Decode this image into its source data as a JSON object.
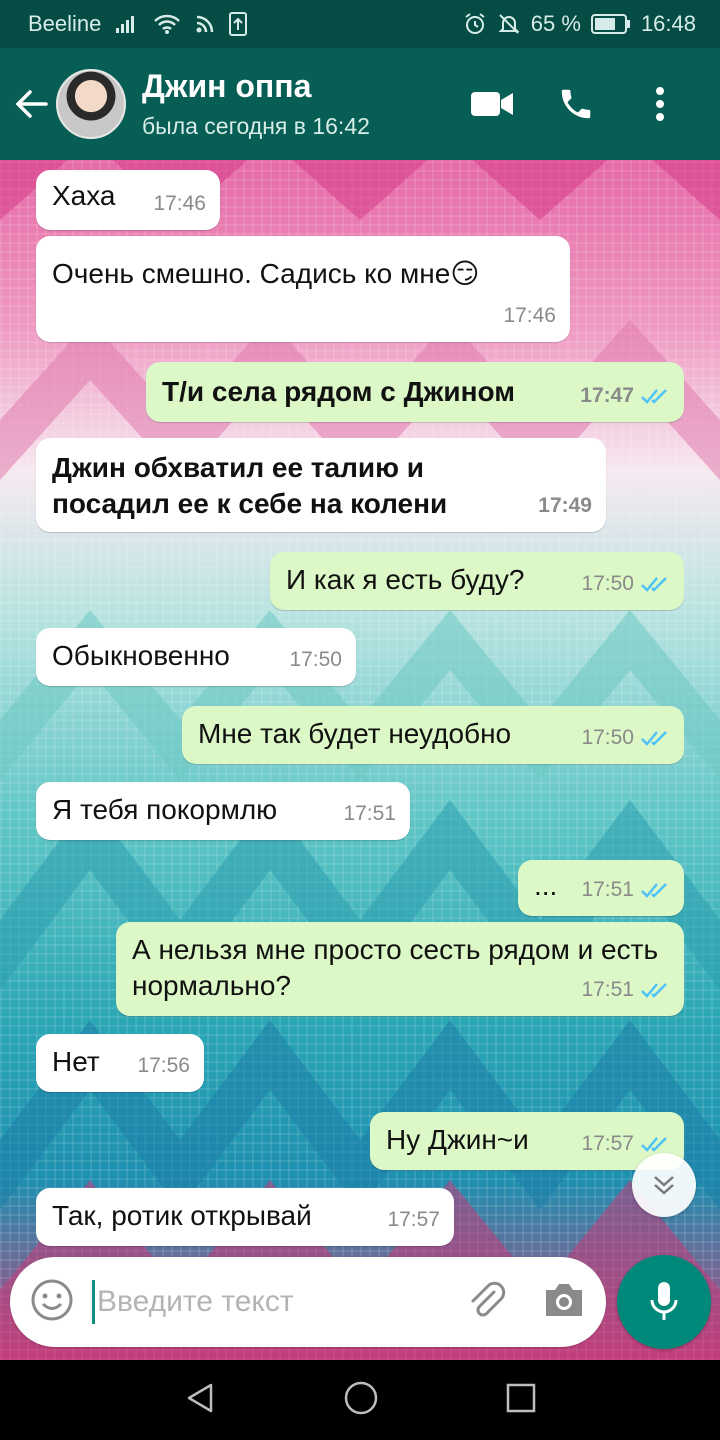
{
  "status_bar": {
    "carrier": "Beeline",
    "battery": "65 %",
    "time": "16:48"
  },
  "header": {
    "name": "Джин оппа",
    "last_seen": "была сегодня в 16:42"
  },
  "messages": [
    {
      "dir": "in",
      "text": "Хаха",
      "time": "17:46"
    },
    {
      "dir": "in",
      "text": "Очень смешно. Садись ко мне😏",
      "time": "17:46"
    },
    {
      "dir": "out",
      "text": "Т/и села рядом с Джином",
      "time": "17:47",
      "bold": true
    },
    {
      "dir": "in",
      "text": "Джин обхватил ее талию и посадил ее к себе на колени",
      "time": "17:49",
      "bold": true
    },
    {
      "dir": "out",
      "text": "И как я есть буду?",
      "time": "17:50"
    },
    {
      "dir": "in",
      "text": "Обыкновенно",
      "time": "17:50"
    },
    {
      "dir": "out",
      "text": "Мне так будет неудобно",
      "time": "17:50"
    },
    {
      "dir": "in",
      "text": "Я тебя покормлю",
      "time": "17:51"
    },
    {
      "dir": "out",
      "text": "...",
      "time": "17:51"
    },
    {
      "dir": "out",
      "text": "А нельзя мне просто сесть рядом и есть нормально?",
      "time": "17:51"
    },
    {
      "dir": "in",
      "text": "Нет",
      "time": "17:56"
    },
    {
      "dir": "out",
      "text": "Ну Джин~и",
      "time": "17:57"
    },
    {
      "dir": "in",
      "text": "Так, ротик открывай",
      "time": "17:57"
    }
  ],
  "input": {
    "placeholder": "Введите текст"
  },
  "colors": {
    "header": "#075e54",
    "statusbar": "#054d44",
    "outgoing": "#dcf8c6",
    "incoming": "#ffffff",
    "accent": "#00897b",
    "read_ticks": "#4fc3f7"
  },
  "icons": [
    "back-arrow-icon",
    "video-call-icon",
    "phone-icon",
    "more-vert-icon",
    "emoji-icon",
    "attach-icon",
    "camera-icon",
    "mic-icon",
    "double-check-icon",
    "scroll-down-icon"
  ]
}
